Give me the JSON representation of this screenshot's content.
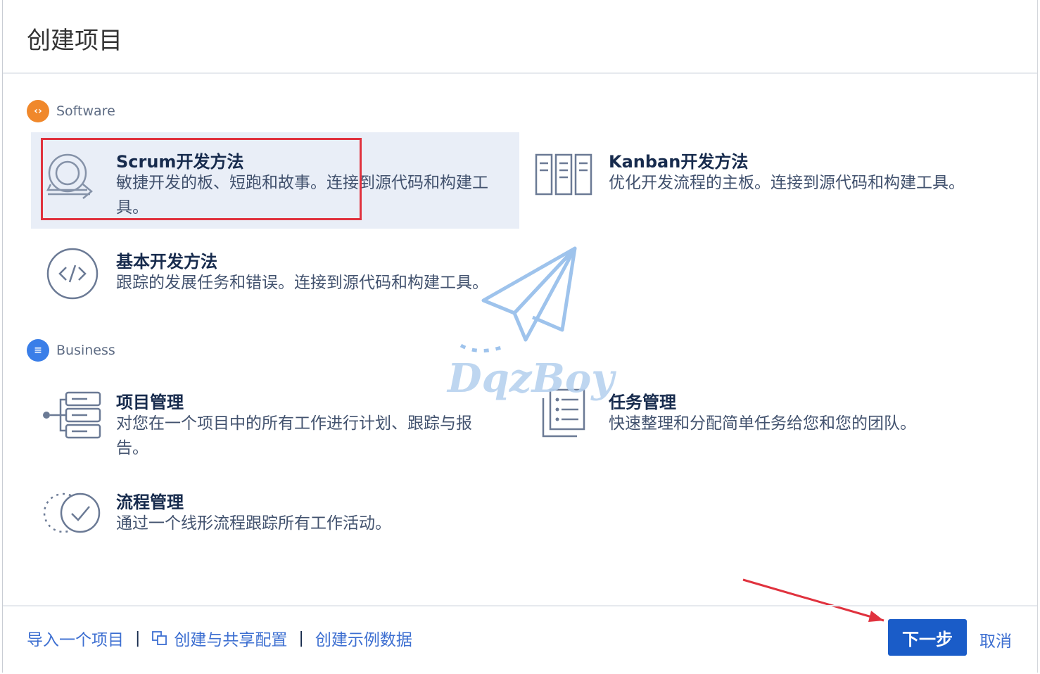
{
  "dialog": {
    "title": "创建项目"
  },
  "sections": {
    "software": {
      "label": "Software",
      "color": "#f0882b"
    },
    "business": {
      "label": "Business",
      "color": "#3a7ee8"
    }
  },
  "templates": {
    "scrum": {
      "title": "Scrum开发方法",
      "desc": "敏捷开发的板、短跑和故事。连接到源代码和构建工具。",
      "icon": "scrum-loop-icon"
    },
    "kanban": {
      "title": "Kanban开发方法",
      "desc": "优化开发流程的主板。连接到源代码和构建工具。",
      "icon": "kanban-board-icon"
    },
    "basic": {
      "title": "基本开发方法",
      "desc": "跟踪的发展任务和错误。连接到源代码和构建工具。",
      "icon": "code-icon"
    },
    "project_mgmt": {
      "title": "项目管理",
      "desc": "对您在一个项目中的所有工作进行计划、跟踪与报告。",
      "icon": "project-stack-icon"
    },
    "task_mgmt": {
      "title": "任务管理",
      "desc": "快速整理和分配简单任务给您和您的团队。",
      "icon": "task-list-icon"
    },
    "process_mgmt": {
      "title": "流程管理",
      "desc": "通过一个线形流程跟踪所有工作活动。",
      "icon": "process-check-icon"
    }
  },
  "footer": {
    "import_link": "导入一个项目",
    "share_config_link": "创建与共享配置",
    "sample_data_link": "创建示例数据",
    "separator": "|",
    "next_button": "下一步",
    "cancel_link": "取消"
  },
  "watermark": {
    "text": "DqzBoy"
  },
  "colors": {
    "accent": "#1a5cc8",
    "link": "#3d6fd1",
    "selected_bg": "#e9eef7",
    "highlight": "#e0323e"
  }
}
